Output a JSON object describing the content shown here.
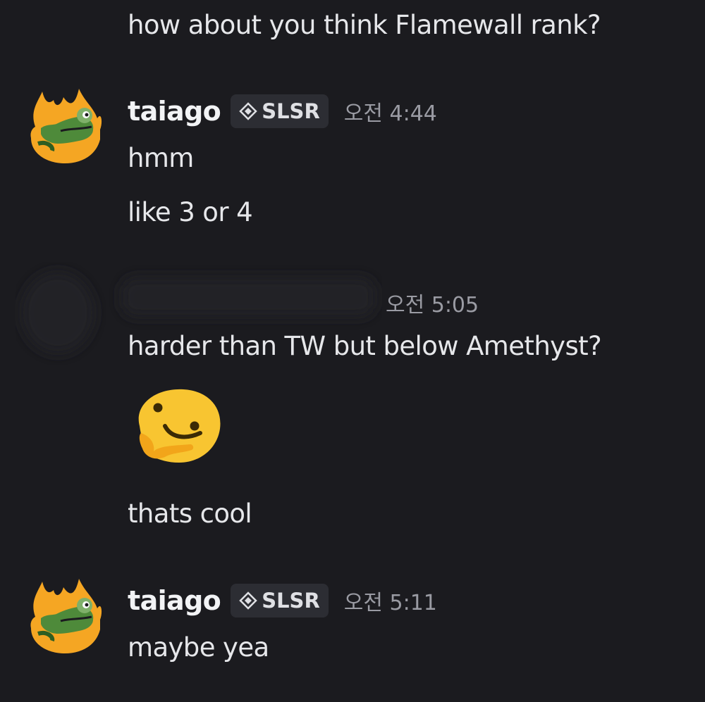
{
  "messages": {
    "prev_message": "how about you think Flamewall rank?",
    "group1": {
      "username": "taiago",
      "tag": "SLSR",
      "time": "오전 4:44",
      "lines": [
        "hmm",
        "like 3 or 4"
      ]
    },
    "group2": {
      "time": "오전 5:05",
      "lines": [
        "harder than TW but below Amethyst?",
        "thats cool"
      ],
      "emoji": "thinking-face-emoji"
    },
    "group3": {
      "username": "taiago",
      "tag": "SLSR",
      "time": "오전 5:11",
      "lines": [
        "maybe yea"
      ]
    }
  },
  "colors": {
    "background": "#1b1b1f",
    "text": "#e6e7ea",
    "timestamp": "#9a9ba3",
    "tag_bg": "#2c2d33",
    "avatar_flame": "#f5a623",
    "avatar_frog": "#4e8a3a"
  },
  "icons": {
    "avatar": "flaming-frog-avatar",
    "tag": "diamond-icon",
    "emoji": "thinking-face-emoji"
  }
}
